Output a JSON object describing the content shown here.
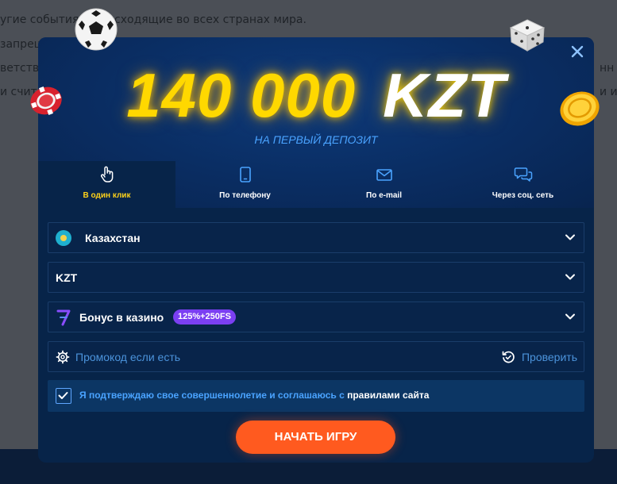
{
  "background": {
    "lines": [
      "угие события, происходящие во всех странах мира.",
      "запреще",
      "ветству",
      "и счита"
    ],
    "right_fragments": [
      "нн",
      "и и"
    ]
  },
  "modal": {
    "headline_amount": "140 000",
    "headline_currency": "KZT",
    "subtitle": "НА ПЕРВЫЙ ДЕПОЗИТ",
    "tabs": [
      {
        "label": "В один клик",
        "icon": "hand-pointer-icon",
        "active": true
      },
      {
        "label": "По телефону",
        "icon": "phone-icon",
        "active": false
      },
      {
        "label": "По e-mail",
        "icon": "envelope-icon",
        "active": false
      },
      {
        "label": "Через соц. сеть",
        "icon": "chat-bubbles-icon",
        "active": false
      }
    ],
    "country": {
      "value": "Казахстан",
      "icon": "kazakhstan-flag-icon"
    },
    "currency": {
      "value": "KZT"
    },
    "bonus": {
      "value": "Бонус в казино",
      "badge": "125%+250FS",
      "icon": "seven-icon"
    },
    "promo": {
      "placeholder": "Промокод если есть",
      "value": "",
      "check_label": "Проверить"
    },
    "agree": {
      "text": "Я подтверждаю свое совершеннолетие и соглашаюсь с ",
      "link": "правилами сайта",
      "checked": true
    },
    "submit_label": "НАЧАТЬ ИГРУ"
  },
  "colors": {
    "accent_orange": "#ff5a1f",
    "headline_yellow": "#ffd800",
    "active_tab": "#ffd21a",
    "link_blue": "#4aa3ff",
    "badge_purple": "#7b3ff2"
  }
}
